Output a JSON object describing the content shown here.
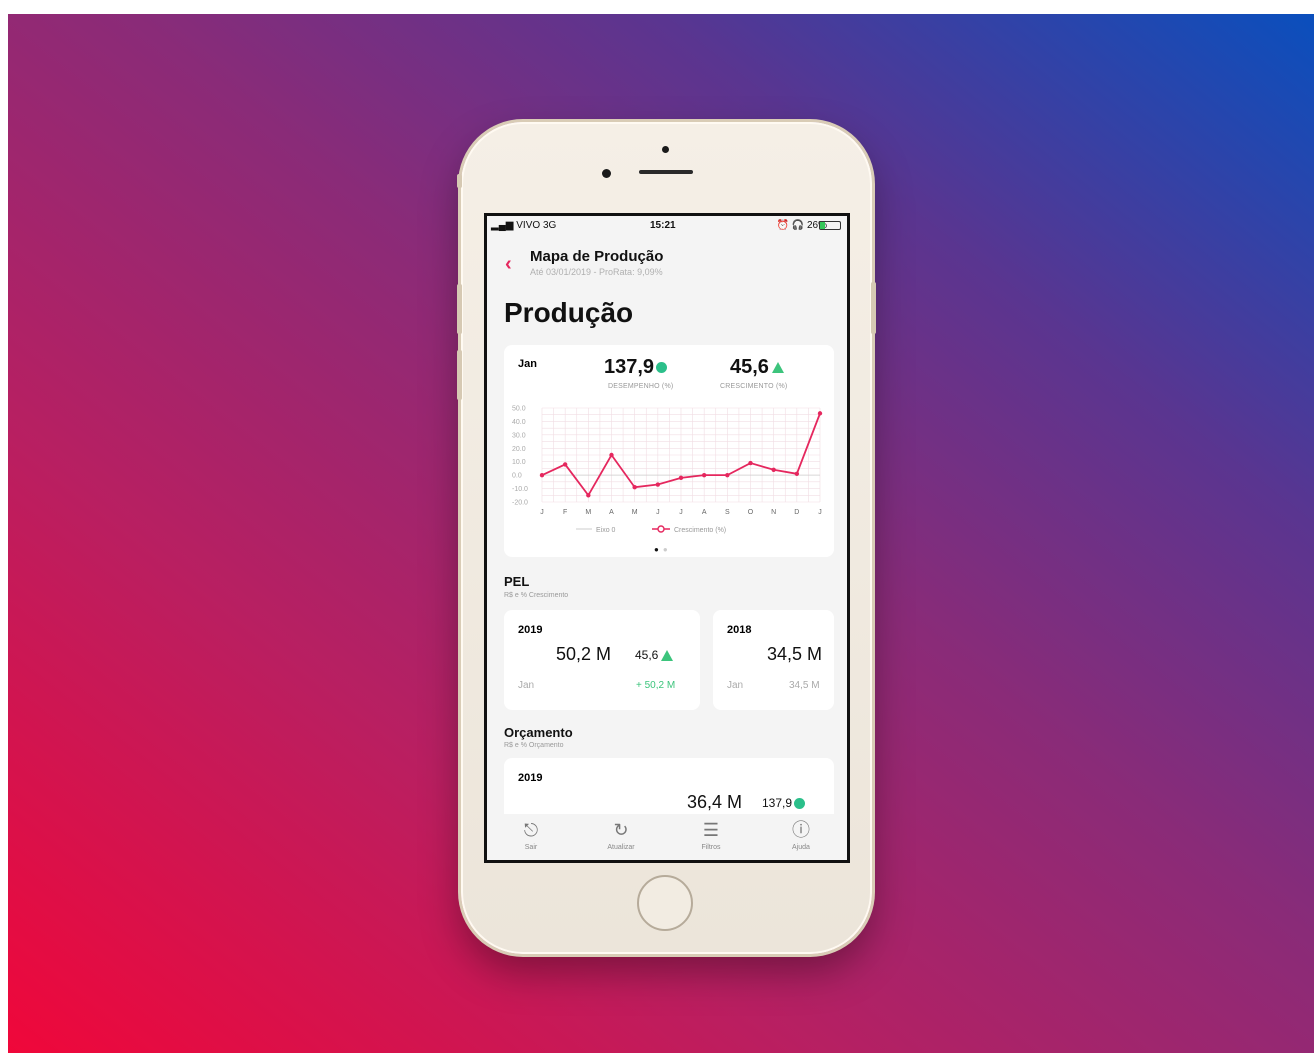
{
  "status_bar": {
    "carrier": "VIVO",
    "network": "3G",
    "time": "15:21",
    "battery": "26%",
    "battery_level": 0.26
  },
  "header": {
    "title": "Mapa de Produção",
    "subtitle": "Até 03/01/2019 - ProRata: 9,09%"
  },
  "page_title": "Produção",
  "summary": {
    "month": "Jan",
    "desempenho": {
      "value": "137,9",
      "label": "DESEMPENHO (%)"
    },
    "crescimento": {
      "value": "45,6",
      "label": "CRESCIMENTO (%)"
    }
  },
  "chart_data": {
    "type": "line",
    "categories": [
      "J",
      "F",
      "M",
      "A",
      "M",
      "J",
      "J",
      "A",
      "S",
      "O",
      "N",
      "D",
      "J"
    ],
    "ylim": [
      -20,
      50
    ],
    "yticks": [
      "50.0",
      "40.0",
      "30.0",
      "20.0",
      "10.0",
      "0.0",
      "-10.0",
      "-20.0"
    ],
    "series": [
      {
        "name": "Eixo 0",
        "values": [
          0,
          0,
          0,
          0,
          0,
          0,
          0,
          0,
          0,
          0,
          0,
          0,
          0
        ],
        "color": "#cccccc"
      },
      {
        "name": "Crescimento (%)",
        "values": [
          0,
          8,
          -15,
          15,
          -9,
          -7,
          -2,
          0,
          0,
          9,
          4,
          1,
          46
        ],
        "color": "#e5275e"
      }
    ],
    "grid": true,
    "legend": "bottom"
  },
  "pel": {
    "title": "PEL",
    "subtitle": "R$ e % Crescimento",
    "cards": [
      {
        "year": "2019",
        "value": "50,2 M",
        "pct": "45,6",
        "month": "Jan",
        "delta": "+ 50,2 M"
      },
      {
        "year": "2018",
        "value": "34,5 M",
        "month": "Jan",
        "foot_value": "34,5 M"
      }
    ]
  },
  "orcamento": {
    "title": "Orçamento",
    "subtitle": "R$ e % Orçamento",
    "card": {
      "year": "2019",
      "value": "36,4 M",
      "pct": "137,9"
    }
  },
  "tabbar": [
    {
      "label": "Sair",
      "icon": "logout-icon"
    },
    {
      "label": "Atualizar",
      "icon": "refresh-icon"
    },
    {
      "label": "Filtros",
      "icon": "filters-icon"
    },
    {
      "label": "Ajuda",
      "icon": "help-icon"
    }
  ],
  "colors": {
    "accent": "#e5275e",
    "positive": "#3cc47c",
    "status_dot": "#2bbf8a"
  }
}
